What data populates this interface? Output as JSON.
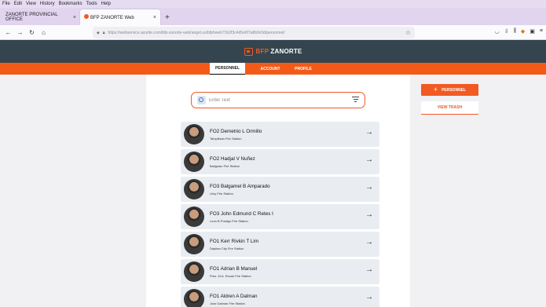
{
  "browser": {
    "menu": [
      "File",
      "Edit",
      "View",
      "History",
      "Bookmarks",
      "Tools",
      "Help"
    ],
    "tabs": [
      {
        "label": "ZANORTE PROVINCIAL OFFICE",
        "close": "×"
      },
      {
        "label": "BFP ZANORTE Web",
        "close": "×"
      }
    ],
    "new_tab": "+",
    "url": "https://webservice.azurite.com/bfp-zanorte-web/angel.us/bfphweb?1b2f3c4d5e6f7a8b9c0d/personnel/",
    "nav_icons": [
      "back-arrow-icon",
      "forward-arrow-icon",
      "reload-icon",
      "home-icon"
    ],
    "right_icons": [
      "pocket-icon",
      "download-icon",
      "library-icon",
      "metamask-icon",
      "extensions-icon",
      "menu-icon"
    ]
  },
  "app": {
    "brand_prefix": "BFP",
    "brand_name": "ZANORTE",
    "tabs": [
      "PERSONNEL",
      "ACCOUNT",
      "PROFILE"
    ],
    "active_tab": "PERSONNEL",
    "search_placeholder": "Enter Text",
    "add_button_label": "PERSONNEL",
    "view_trash_label": "VIEW TRASH",
    "accent_color": "#f15a22",
    "header_color": "#34454f",
    "personnel": [
      {
        "name": "FO2 Demetrio L Ormillo",
        "station": "Tampilisan Fire Station"
      },
      {
        "name": "FO2 Hadjal V Nuñez",
        "station": "Baliguian Fire Station"
      },
      {
        "name": "FO3 Balgamel B Amparado",
        "station": "Liloy Fire Station"
      },
      {
        "name": "FO3 John Edmund C Retes I",
        "station": "Leon B Postigo Fire Station"
      },
      {
        "name": "FO1 Kerr Rivkin T Lim",
        "station": "Dapitan City Fire Station"
      },
      {
        "name": "FO1 Adrian B Manuel",
        "station": "Pres. M.A. Roxas Fire Station"
      },
      {
        "name": "FO1 Aldren A Dalman",
        "station": "Jose Dalman Fire Station"
      }
    ]
  }
}
